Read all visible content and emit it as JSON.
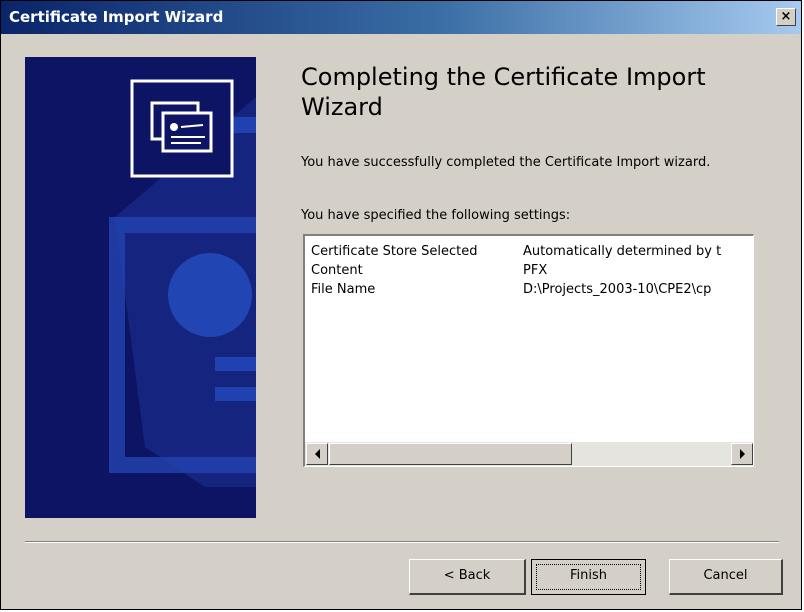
{
  "window": {
    "title": "Certificate Import Wizard",
    "close_label": "×"
  },
  "main": {
    "heading": "Completing the Certificate Import Wizard",
    "success_text": "You have successfully completed the Certificate Import wizard.",
    "settings_label": "You have specified the following settings:",
    "settings": [
      {
        "key": "Certificate Store Selected",
        "value": "Automatically determined by t"
      },
      {
        "key": "Content",
        "value": "PFX"
      },
      {
        "key": "File Name",
        "value": "D:\\Projects_2003-10\\CPE2\\cp"
      }
    ]
  },
  "buttons": {
    "back": "< Back",
    "finish": "Finish",
    "cancel": "Cancel"
  },
  "colors": {
    "banner": "#0e1464",
    "title_gradient_start": "#0a246a",
    "dialog_bg": "#d4d0c8"
  },
  "icons": {
    "banner": "certificate-icon",
    "scroll_left": "arrow-left-icon",
    "scroll_right": "arrow-right-icon"
  }
}
